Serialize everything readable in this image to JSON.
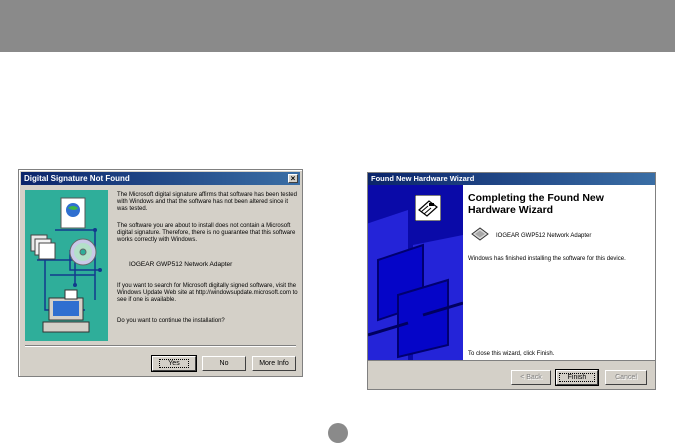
{
  "dialog1": {
    "title": "Digital Signature Not Found",
    "para1": "The Microsoft digital signature affirms that software has been tested with Windows and that the software has not been altered since it was tested.",
    "para2": "The software you are about to install does not contain a Microsoft digital signature. Therefore, there is no guarantee that this software works correctly with Windows.",
    "adapter": "IOGEAR GWP512 Network Adapter",
    "para3": "If you want to search for Microsoft digitally signed software, visit the Windows Update Web site at http://windowsupdate.microsoft.com to see if one is available.",
    "question": "Do you want to continue the installation?",
    "buttons": {
      "yes": "Yes",
      "no": "No",
      "more_info": "More Info"
    }
  },
  "dialog2": {
    "title": "Found New Hardware Wizard",
    "heading": "Completing the Found New Hardware Wizard",
    "adapter": "IOGEAR GWP512 Network Adapter",
    "finished": "Windows has finished installing the software for this device.",
    "close_hint": "To close this wizard, click Finish.",
    "buttons": {
      "back": "< Back",
      "finish": "Finish",
      "cancel": "Cancel"
    }
  },
  "colors": {
    "titlebar_start": "#0a246a",
    "titlebar_end": "#3a6ea5",
    "dialog_face": "#d4d0c8",
    "wizard_side": "#0a0aa8",
    "signature_art": "#2fae9a",
    "page_bar": "#8a8a8a"
  }
}
